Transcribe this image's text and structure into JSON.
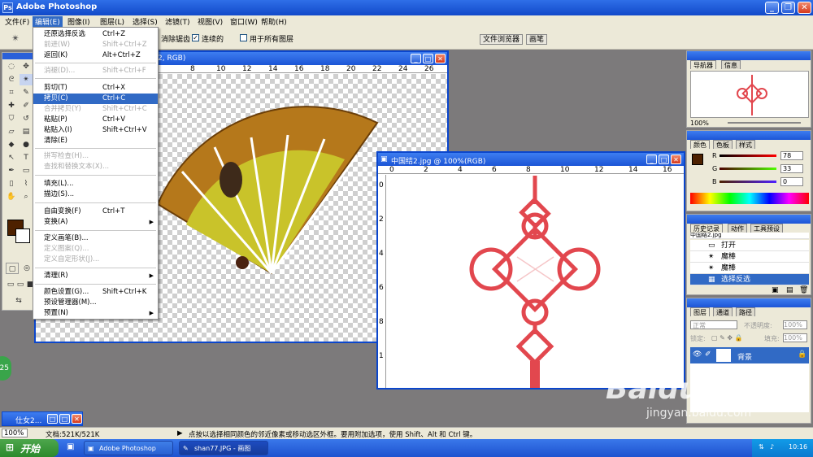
{
  "window": {
    "title": "Adobe Photoshop",
    "app_icon": "Ps"
  },
  "menubar": [
    {
      "label": "文件(F)"
    },
    {
      "label": "编辑(E)"
    },
    {
      "label": "图像(I)"
    },
    {
      "label": "图层(L)"
    },
    {
      "label": "选择(S)"
    },
    {
      "label": "滤镜(T)"
    },
    {
      "label": "视图(V)"
    },
    {
      "label": "窗口(W)"
    },
    {
      "label": "帮助(H)"
    }
  ],
  "options": {
    "antialias": "消除锯齿",
    "contiguous": "连续的",
    "all_layers": "用于所有图层",
    "tab_file_browser": "文件浏览器",
    "tab_brushes": "画笔"
  },
  "edit_menu": [
    {
      "label": "还原选择反选",
      "shortcut": "Ctrl+Z",
      "state": "normal"
    },
    {
      "label": "前进(W)",
      "shortcut": "Shift+Ctrl+Z",
      "state": "disabled"
    },
    {
      "label": "返回(K)",
      "shortcut": "Alt+Ctrl+Z",
      "state": "normal"
    },
    {
      "sep": true
    },
    {
      "label": "消褪(D)...",
      "shortcut": "Shift+Ctrl+F",
      "state": "disabled"
    },
    {
      "sep": true
    },
    {
      "label": "剪切(T)",
      "shortcut": "Ctrl+X",
      "state": "normal"
    },
    {
      "label": "拷贝(C)",
      "shortcut": "Ctrl+C",
      "state": "highlight"
    },
    {
      "label": "合并拷贝(Y)",
      "shortcut": "Shift+Ctrl+C",
      "state": "disabled"
    },
    {
      "label": "粘贴(P)",
      "shortcut": "Ctrl+V",
      "state": "normal"
    },
    {
      "label": "粘贴入(I)",
      "shortcut": "Shift+Ctrl+V",
      "state": "normal"
    },
    {
      "label": "清除(E)",
      "shortcut": "",
      "state": "normal"
    },
    {
      "sep": true
    },
    {
      "label": "拼写检查(H)...",
      "shortcut": "",
      "state": "disabled"
    },
    {
      "label": "查找和替换文本(X)...",
      "shortcut": "",
      "state": "disabled"
    },
    {
      "sep": true
    },
    {
      "label": "填充(L)...",
      "shortcut": "",
      "state": "normal"
    },
    {
      "label": "描边(S)...",
      "shortcut": "",
      "state": "normal"
    },
    {
      "sep": true
    },
    {
      "label": "自由变换(F)",
      "shortcut": "Ctrl+T",
      "state": "normal"
    },
    {
      "label": "变换(A)",
      "shortcut": "",
      "state": "normal",
      "submenu": true
    },
    {
      "sep": true
    },
    {
      "label": "定义画笔(B)...",
      "shortcut": "",
      "state": "normal"
    },
    {
      "label": "定义图案(Q)...",
      "shortcut": "",
      "state": "disabled"
    },
    {
      "label": "定义自定形状(J)...",
      "shortcut": "",
      "state": "disabled"
    },
    {
      "sep": true
    },
    {
      "label": "清理(R)",
      "shortcut": "",
      "state": "normal",
      "submenu": true
    },
    {
      "sep": true
    },
    {
      "label": "颜色设置(G)...",
      "shortcut": "Shift+Ctrl+K",
      "state": "normal"
    },
    {
      "label": "预设管理器(M)...",
      "shortcut": "",
      "state": "normal"
    },
    {
      "label": "预置(N)",
      "shortcut": "",
      "state": "normal",
      "submenu": true
    }
  ],
  "doc1": {
    "title": "2, RGB)",
    "ruler": [
      "8",
      "10",
      "12",
      "14",
      "16",
      "18",
      "20",
      "22",
      "24",
      "26"
    ]
  },
  "doc2": {
    "title": "中国结2.jpg @ 100%(RGB)",
    "ruler_h": [
      "0",
      "2",
      "4",
      "6",
      "8",
      "10",
      "12",
      "14",
      "16"
    ],
    "ruler_v": [
      "0",
      "2",
      "4",
      "6",
      "8",
      "1"
    ]
  },
  "minimized": {
    "title": "仕女2..."
  },
  "navigator": {
    "tabs": [
      "导航器",
      "信息"
    ],
    "zoom": "100%"
  },
  "color": {
    "tabs": [
      "颜色",
      "色板",
      "样式"
    ],
    "r_label": "R",
    "g_label": "G",
    "b_label": "B",
    "r": "78",
    "g": "33",
    "b": "0",
    "fg": "#4e2100"
  },
  "history": {
    "tabs": [
      "历史记录",
      "动作",
      "工具预设"
    ],
    "items": [
      "打开",
      "魔棒",
      "魔棒",
      "选择反选"
    ],
    "top": "中国结2.jpg"
  },
  "layers": {
    "tabs": [
      "图层",
      "通道",
      "路径"
    ],
    "mode": "正常",
    "opacity_label": "不透明度:",
    "opacity": "100%",
    "lock_label": "锁定:",
    "fill_label": "填充:",
    "fill": "100%",
    "layer_name": "背景"
  },
  "status": {
    "zoom": "100%",
    "doc": "文档:521K/521K",
    "hint": "点按以选择相同颜色的邻近像素或移动选区外框。要用附加选项，使用 Shift、Alt 和 Ctrl 键。"
  },
  "taskbar": {
    "start": "开始",
    "items": [
      "Adobe Photoshop",
      "shan77.JPG - 画图"
    ],
    "clock": "10:16"
  },
  "badge": "25",
  "watermark": {
    "brand": "Baidu",
    "sub": "经验",
    "url": "jingyan.baidu.com"
  }
}
